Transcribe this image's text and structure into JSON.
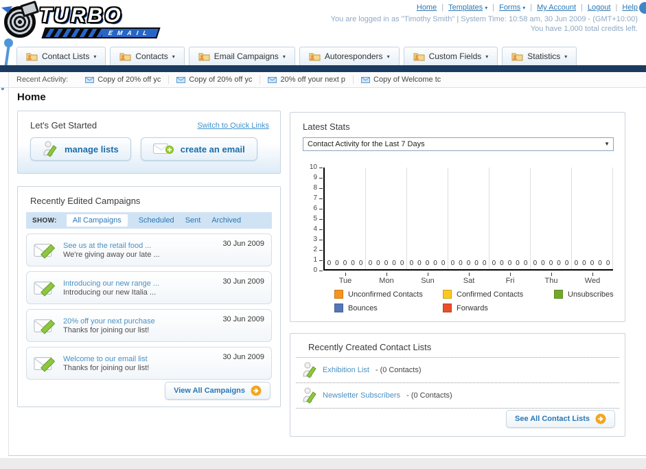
{
  "header": {
    "logo_line1": "TURBO",
    "logo_line2": "EMAIL",
    "nav_items": [
      {
        "label": "Home",
        "dropdown": false
      },
      {
        "label": "Templates",
        "dropdown": true
      },
      {
        "label": "Forms",
        "dropdown": true
      },
      {
        "label": "My Account",
        "dropdown": false
      },
      {
        "label": "Logout",
        "dropdown": false
      },
      {
        "label": "Help",
        "dropdown": false
      }
    ],
    "login_info": "You are logged in as \"Timothy Smith\" | System Time: 10:58 am, 30 Jun 2009 - (GMT+10:00)",
    "credits_info": "You have 1,000 total credits left."
  },
  "tabs": [
    {
      "label": "Contact Lists"
    },
    {
      "label": "Contacts"
    },
    {
      "label": "Email Campaigns"
    },
    {
      "label": "Autoresponders"
    },
    {
      "label": "Custom Fields"
    },
    {
      "label": "Statistics"
    }
  ],
  "recent_activity": {
    "label": "Recent Activity:",
    "items": [
      {
        "text": "Copy of 20% off yc"
      },
      {
        "text": "Copy of 20% off yc"
      },
      {
        "text": "20% off your next p"
      },
      {
        "text": "Copy of Welcome tc"
      }
    ]
  },
  "page_title": "Home",
  "get_started": {
    "title": "Let's Get Started",
    "switch_link": "Switch to Quick Links",
    "manage_lists_label": "manage lists",
    "create_email_label": "create an email"
  },
  "campaigns_panel": {
    "title": "Recently Edited Campaigns",
    "show_label": "SHOW:",
    "filters": [
      {
        "label": "All Campaigns",
        "active": true
      },
      {
        "label": "Scheduled",
        "active": false
      },
      {
        "label": "Sent",
        "active": false
      },
      {
        "label": "Archived",
        "active": false
      }
    ],
    "items": [
      {
        "title": "See us at the retail food ...",
        "subtitle": "We're giving away our late ...",
        "date": "30 Jun 2009"
      },
      {
        "title": "Introducing our new range ...",
        "subtitle": "Introducing our new Italia ...",
        "date": "30 Jun 2009"
      },
      {
        "title": "20% off your next purchase",
        "subtitle": "Thanks for joining our list!",
        "date": "30 Jun 2009"
      },
      {
        "title": "Welcome to our email list",
        "subtitle": "Thanks for joining our list!",
        "date": "30 Jun 2009"
      }
    ],
    "view_all_label": "View All Campaigns"
  },
  "stats_panel": {
    "title": "Latest Stats",
    "dropdown_value": "Contact Activity for the Last 7 Days"
  },
  "chart_data": {
    "type": "bar",
    "title": "Contact Activity for the Last 7 Days",
    "categories": [
      "Tue",
      "Mon",
      "Sun",
      "Sat",
      "Fri",
      "Thu",
      "Wed"
    ],
    "series": [
      {
        "name": "Unconfirmed Contacts",
        "color": "#f7941d",
        "values": [
          0,
          0,
          0,
          0,
          0,
          0,
          0
        ]
      },
      {
        "name": "Confirmed Contacts",
        "color": "#fcc822",
        "values": [
          0,
          0,
          0,
          0,
          0,
          0,
          0
        ]
      },
      {
        "name": "Unsubscribes",
        "color": "#72a82a",
        "values": [
          0,
          0,
          0,
          0,
          0,
          0,
          0
        ]
      },
      {
        "name": "Bounces",
        "color": "#5575b5",
        "values": [
          0,
          0,
          0,
          0,
          0,
          0,
          0
        ]
      },
      {
        "name": "Forwards",
        "color": "#e8502c",
        "values": [
          0,
          0,
          0,
          0,
          0,
          0,
          0
        ]
      }
    ],
    "ylim": [
      0,
      10
    ],
    "yticks": [
      0,
      1,
      2,
      3,
      4,
      5,
      6,
      7,
      8,
      9,
      10
    ],
    "grid": true,
    "legend_position": "bottom"
  },
  "contact_lists_panel": {
    "title": "Recently Created Contact Lists",
    "items": [
      {
        "name": "Exhibition List",
        "suffix": "- (0 Contacts)"
      },
      {
        "name": "Newsletter Subscribers",
        "suffix": "- (0 Contacts)"
      }
    ],
    "see_all_label": "See All Contact Lists"
  }
}
